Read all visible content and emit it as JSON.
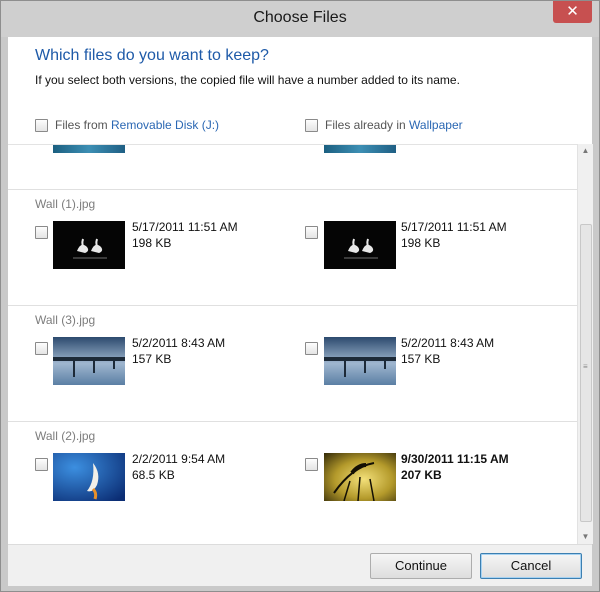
{
  "window": {
    "title": "Choose Files",
    "close_glyph": "✕"
  },
  "dialog": {
    "heading": "Which files do you want to keep?",
    "description": "If you select both versions, the copied file will have a number added to its name."
  },
  "columns": {
    "left": {
      "prefix": "Files from ",
      "source": "Removable Disk (J:)"
    },
    "right": {
      "prefix": "Files already in ",
      "source": "Wallpaper"
    }
  },
  "groups": [
    {
      "name": "Wall (1).jpg",
      "left": {
        "date": "5/17/2011 11:51 AM",
        "size": "198 KB",
        "thumb": "swans-thumbnail"
      },
      "right": {
        "date": "5/17/2011 11:51 AM",
        "size": "198 KB",
        "thumb": "swans-thumbnail"
      }
    },
    {
      "name": "Wall (3).jpg",
      "left": {
        "date": "5/2/2011 8:43 AM",
        "size": "157 KB",
        "thumb": "pier-thumbnail"
      },
      "right": {
        "date": "5/2/2011 8:43 AM",
        "size": "157 KB",
        "thumb": "pier-thumbnail"
      }
    },
    {
      "name": "Wall (2).jpg",
      "left": {
        "date": "2/2/2011 9:54 AM",
        "size": "68.5 KB",
        "thumb": "blue-abstract-thumbnail"
      },
      "right": {
        "date": "9/30/2011 11:15 AM",
        "size": "207 KB",
        "thumb": "grass-sunset-thumbnail",
        "newer": true
      }
    }
  ],
  "footer": {
    "continue_label": "Continue",
    "cancel_label": "Cancel"
  },
  "colors": {
    "heading": "#1e5aa8",
    "link": "#2a67b3",
    "close": "#c75050"
  }
}
